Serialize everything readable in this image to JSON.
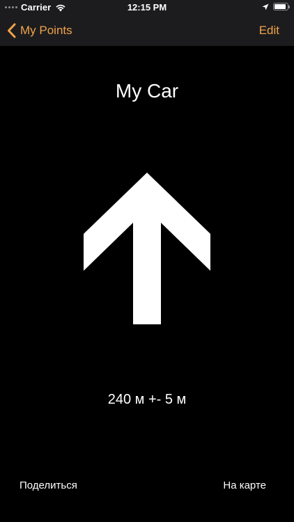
{
  "status_bar": {
    "carrier": "Carrier",
    "time": "12:15 PM",
    "battery_level": 0.9
  },
  "nav": {
    "back_label": "My Points",
    "edit_label": "Edit"
  },
  "point": {
    "name": "My Car",
    "distance": "240 м +- 5 м"
  },
  "actions": {
    "share_label": "Поделиться",
    "map_label": "На карте"
  },
  "colors": {
    "accent": "#f0a34a",
    "background": "#000000",
    "bar_background": "#1c1c1e"
  }
}
